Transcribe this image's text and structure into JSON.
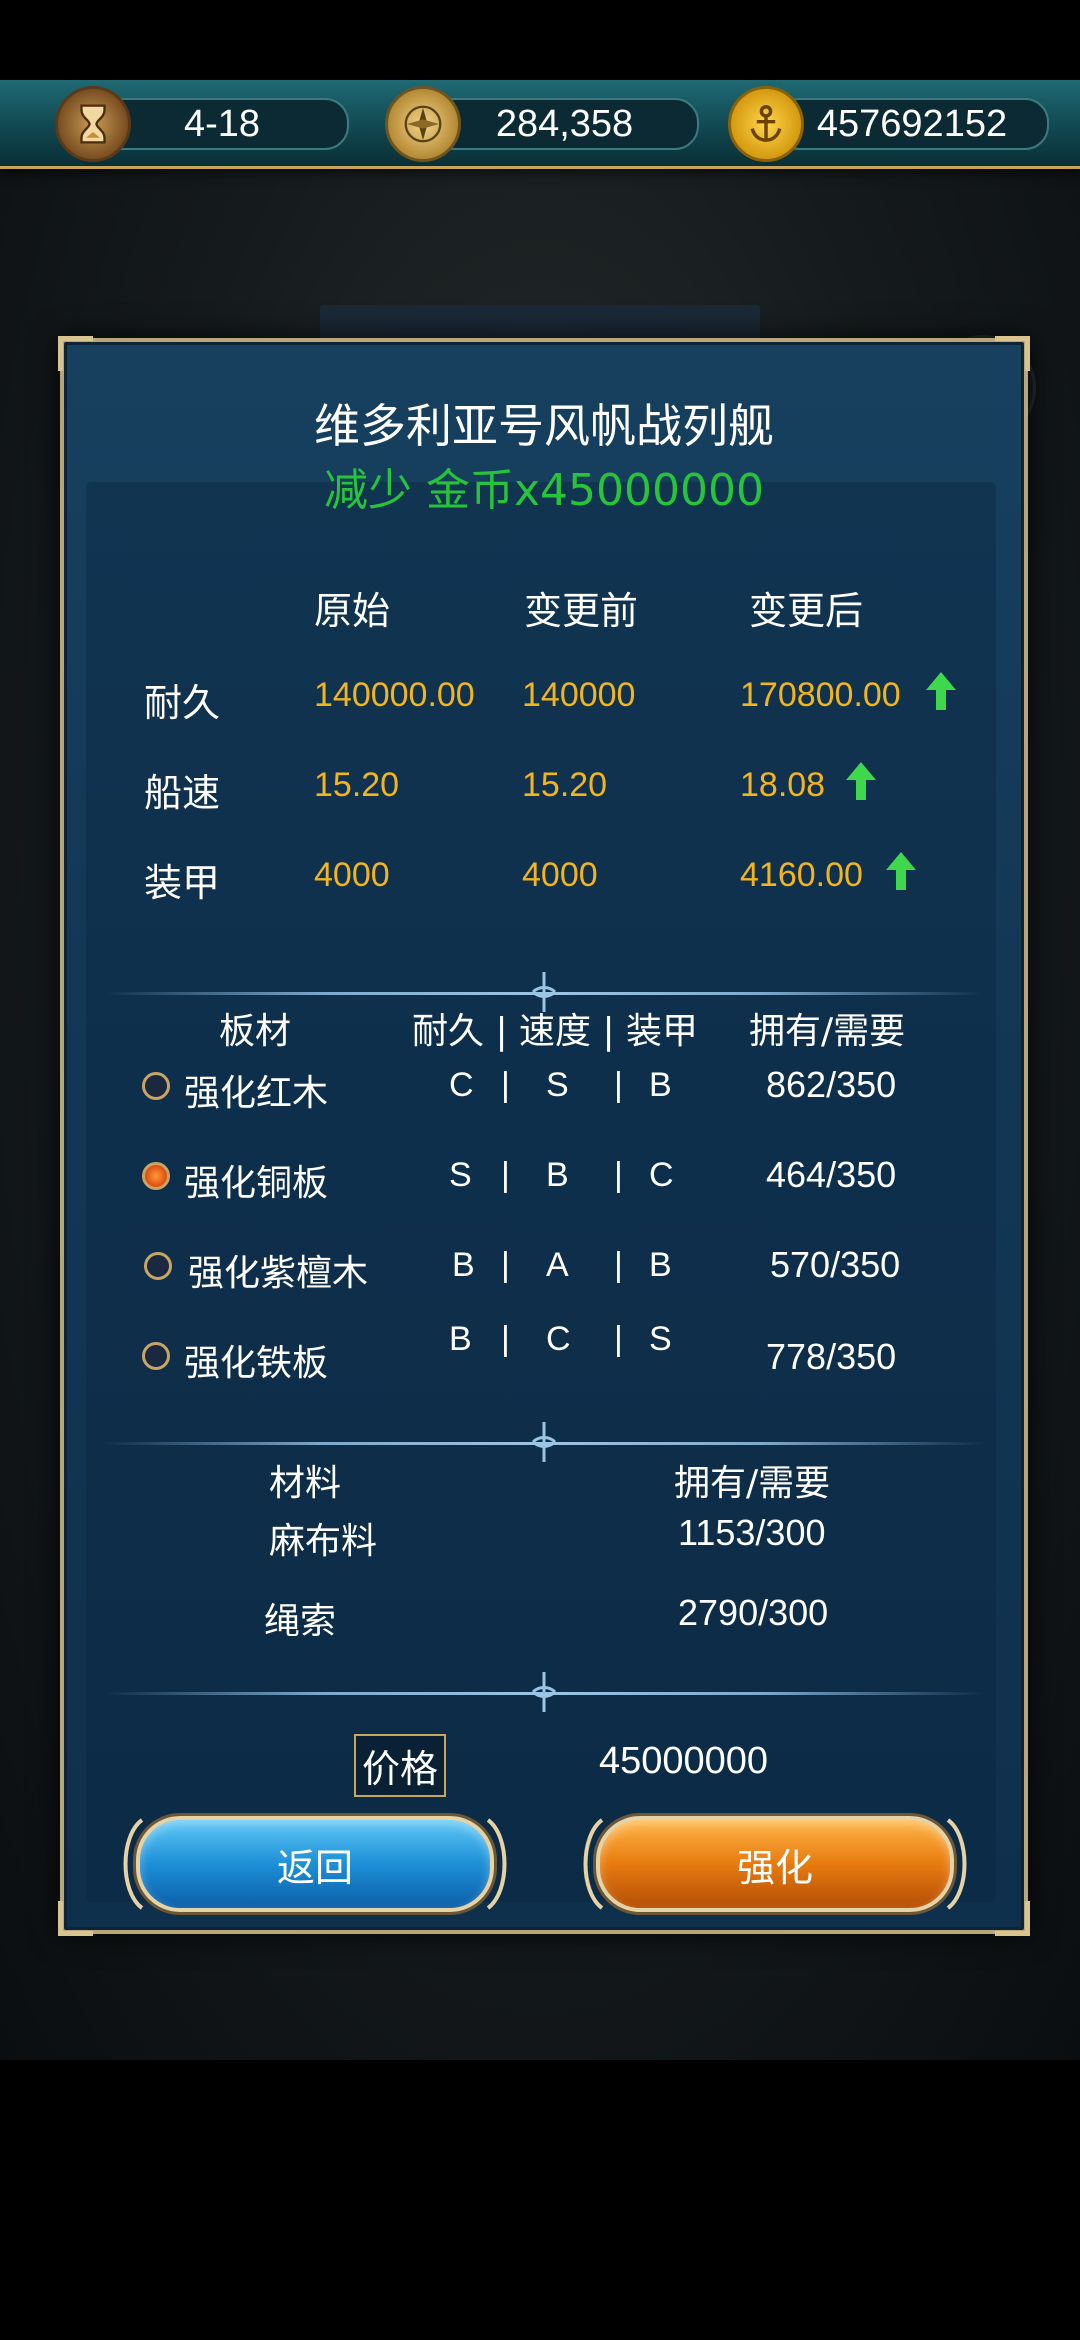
{
  "topbar": {
    "stage": "4-18",
    "compass_value": "284,358",
    "gold_value": "457692152",
    "icons": [
      "hourglass-icon",
      "compass-icon",
      "anchor-icon"
    ]
  },
  "dialog": {
    "title": "维多利亚号风帆战列舰",
    "subtitle": "减少 金币x45000000",
    "stats_headers": {
      "original": "原始",
      "before": "变更前",
      "after": "变更后"
    },
    "stats": [
      {
        "label": "耐久",
        "original": "140000.00",
        "before": "140000",
        "after": "170800.00",
        "arrow": "up-arrow-icon"
      },
      {
        "label": "船速",
        "original": "15.20",
        "before": "15.20",
        "after": "18.08",
        "arrow": "up-arrow-icon"
      },
      {
        "label": "装甲",
        "original": "4000",
        "before": "4000",
        "after": "4160.00",
        "arrow": "up-arrow-icon"
      }
    ],
    "plank_headers": {
      "material": "板材",
      "grades": "耐久 | 速度 | 装甲",
      "owned": "拥有/需要"
    },
    "planks": [
      {
        "name": "强化红木",
        "g1": "C",
        "g2": "S",
        "g3": "B",
        "count": "862/350",
        "selected": false
      },
      {
        "name": "强化铜板",
        "g1": "S",
        "g2": "B",
        "g3": "C",
        "count": "464/350",
        "selected": true
      },
      {
        "name": "强化紫檀木",
        "g1": "B",
        "g2": "A",
        "g3": "B",
        "count": "570/350",
        "selected": false
      },
      {
        "name": "强化铁板",
        "g1": "B",
        "g2": "C",
        "g3": "S",
        "count": "778/350",
        "selected": false
      }
    ],
    "material_headers": {
      "material": "材料",
      "owned": "拥有/需要"
    },
    "materials": [
      {
        "name": "麻布料",
        "count": "1153/300"
      },
      {
        "name": "绳索",
        "count": "2790/300"
      }
    ],
    "price_label": "价格",
    "price_value": "45000000",
    "back_label": "返回",
    "upgrade_label": "强化",
    "colors": {
      "accent_gold": "#f2b51c",
      "green": "#27c43a",
      "frame": "#b9a679"
    }
  }
}
